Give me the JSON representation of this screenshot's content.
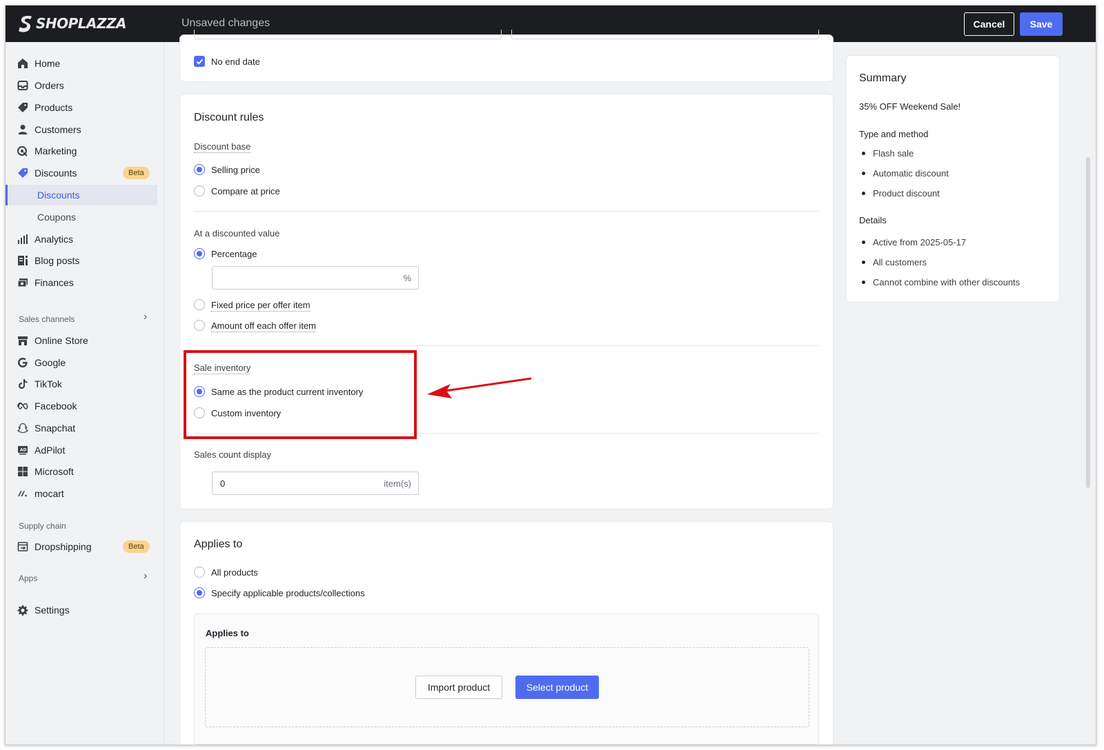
{
  "header": {
    "brand": "SHOPLAZZA",
    "status": "Unsaved changes",
    "cancel_label": "Cancel",
    "save_label": "Save"
  },
  "sidebar": {
    "items": [
      {
        "label": "Home",
        "icon": "home-icon"
      },
      {
        "label": "Orders",
        "icon": "inbox-icon"
      },
      {
        "label": "Products",
        "icon": "tag-icon"
      },
      {
        "label": "Customers",
        "icon": "person-icon"
      },
      {
        "label": "Marketing",
        "icon": "target-icon"
      },
      {
        "label": "Discounts",
        "icon": "discount-tag-icon",
        "badge": "Beta"
      },
      {
        "label": "Discounts",
        "sub": true,
        "active": true
      },
      {
        "label": "Coupons",
        "sub": true
      },
      {
        "label": "Analytics",
        "icon": "bar-chart-icon"
      },
      {
        "label": "Blog posts",
        "icon": "blog-icon"
      },
      {
        "label": "Finances",
        "icon": "finances-icon"
      }
    ],
    "sales_channels_label": "Sales channels",
    "channels": [
      {
        "label": "Online Store",
        "icon": "store-icon"
      },
      {
        "label": "Google",
        "icon": "google-icon"
      },
      {
        "label": "TikTok",
        "icon": "tiktok-icon"
      },
      {
        "label": "Facebook",
        "icon": "meta-icon"
      },
      {
        "label": "Snapchat",
        "icon": "snapchat-icon"
      },
      {
        "label": "AdPilot",
        "icon": "adpilot-icon"
      },
      {
        "label": "Microsoft",
        "icon": "microsoft-icon"
      },
      {
        "label": "mocart",
        "icon": "mocart-icon"
      }
    ],
    "supply_chain_label": "Supply chain",
    "dropshipping": {
      "label": "Dropshipping",
      "badge": "Beta",
      "icon": "dropshipping-icon"
    },
    "apps_label": "Apps",
    "settings_label": "Settings"
  },
  "active_dates": {
    "no_end_date_label": "No end date",
    "no_end_date_checked": true
  },
  "discount_rules": {
    "title": "Discount rules",
    "base_label": "Discount base",
    "base_options": [
      "Selling price",
      "Compare at price"
    ],
    "base_selected": 0,
    "value_label": "At a discounted value",
    "value_options": [
      "Percentage",
      "Fixed price per offer item",
      "Amount off each offer item"
    ],
    "value_selected": 0,
    "percentage_value": "",
    "percentage_suffix": "%",
    "inventory_label": "Sale inventory",
    "inventory_options": [
      "Same as the product current inventory",
      "Custom inventory"
    ],
    "inventory_selected": 0,
    "sales_count_label": "Sales count display",
    "sales_count_value": "0",
    "sales_count_suffix": "item(s)"
  },
  "applies_to": {
    "title": "Applies to",
    "options": [
      "All products",
      "Specify applicable products/collections"
    ],
    "selected": 1,
    "inner_title": "Applies to",
    "import_label": "Import product",
    "select_label": "Select product"
  },
  "summary": {
    "title": "Summary",
    "name": "35% OFF Weekend Sale!",
    "type_heading": "Type and method",
    "type_items": [
      "Flash sale",
      "Automatic discount",
      "Product discount"
    ],
    "details_heading": "Details",
    "details_items": [
      "Active from 2025-05-17",
      "All customers",
      "Cannot combine with other discounts"
    ]
  },
  "colors": {
    "accent": "#4f6cf0",
    "highlight": "#d90f16",
    "topbar": "#1c1d20",
    "beta_badge": "#fbd58f"
  }
}
